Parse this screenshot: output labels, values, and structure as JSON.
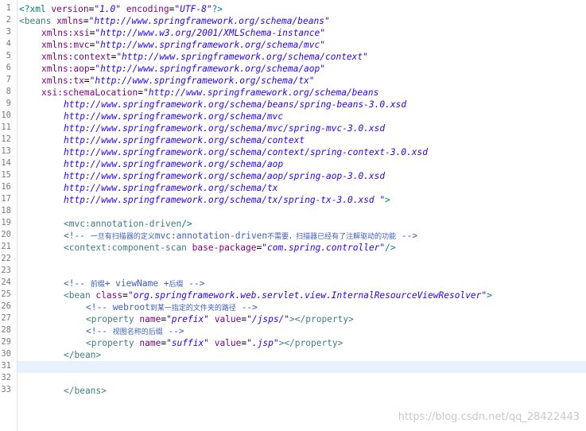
{
  "editor": {
    "current_line": 31,
    "line_numbers": [
      "1",
      "2",
      "3",
      "4",
      "5",
      "6",
      "7",
      "8",
      "9",
      "10",
      "11",
      "12",
      "13",
      "14",
      "15",
      "16",
      "17",
      "18",
      "19",
      "20",
      "21",
      "22",
      "23",
      "24",
      "25",
      "26",
      "27",
      "28",
      "29",
      "30",
      "31",
      "32",
      "33"
    ],
    "lines": {
      "l1": {
        "a": "<?xml ",
        "b": "version",
        "c": "=",
        "d": "\"1.0\"",
        "e": " ",
        "f": "encoding",
        "g": "=",
        "h": "\"UTF-8\"",
        "i": "?>"
      },
      "l2": {
        "a": "<beans ",
        "b": "xmlns",
        "c": "=",
        "d": "\"http://www.springframework.org/schema/beans\""
      },
      "l3": {
        "b": "xmlns:xsi",
        "c": "=",
        "d": "\"http://www.w3.org/2001/XMLSchema-instance\""
      },
      "l4": {
        "b": "xmlns:mvc",
        "c": "=",
        "d": "\"http://www.springframework.org/schema/mvc\""
      },
      "l5": {
        "b": "xmlns:context",
        "c": "=",
        "d": "\"http://www.springframework.org/schema/context\""
      },
      "l6": {
        "b": "xmlns:aop",
        "c": "=",
        "d": "\"http://www.springframework.org/schema/aop\""
      },
      "l7": {
        "b": "xmlns:tx",
        "c": "=",
        "d": "\"http://www.springframework.org/schema/tx\""
      },
      "l8": {
        "b": "xsi:schemaLocation",
        "c": "=",
        "d": "\"http://www.springframework.org/schema/beans"
      },
      "l9": {
        "d": "http://www.springframework.org/schema/beans/spring-beans-3.0.xsd"
      },
      "l10": {
        "d": "http://www.springframework.org/schema/mvc"
      },
      "l11": {
        "d": "http://www.springframework.org/schema/mvc/spring-mvc-3.0.xsd"
      },
      "l12": {
        "d": "http://www.springframework.org/schema/context"
      },
      "l13": {
        "d": "http://www.springframework.org/schema/context/spring-context-3.0.xsd"
      },
      "l14": {
        "d": "http://www.springframework.org/schema/aop"
      },
      "l15": {
        "d": "http://www.springframework.org/schema/aop/spring-aop-3.0.xsd"
      },
      "l16": {
        "d": "http://www.springframework.org/schema/tx"
      },
      "l17": {
        "d": "http://www.springframework.org/schema/tx/spring-tx-3.0.xsd \"",
        "i": ">"
      },
      "l19": {
        "a": "<mvc:annotation-driven",
        "i": "/>"
      },
      "l20": {
        "a": "<!-- ",
        "b": "一旦有扫描器的定义",
        "c": "mvc:annotation-driven",
        "d": "不需要，扫描器已经有了注解驱动的功能",
        "e": " -->"
      },
      "l21": {
        "a": "<context:component-scan ",
        "b": "base-package",
        "c": "=",
        "d": "\"com.spring.controller\"",
        "i": "/>"
      },
      "l24": {
        "a": "<!-- ",
        "b": "前缀",
        "c": "+ viewName +",
        "d": "后缀",
        "e": " -->"
      },
      "l25": {
        "a": "<bean ",
        "b": "class",
        "c": "=",
        "d": "\"org.springframework.web.servlet.view.InternalResourceViewResolver\"",
        "i": ">"
      },
      "l26": {
        "a": "<!-- ",
        "c": "webroot",
        "d": "到某一指定的文件夹的路径",
        "e": " -->"
      },
      "l27": {
        "a": "<property ",
        "b": "name",
        "c": "=",
        "d": "\"prefix\"",
        "e": " ",
        "f": "value",
        "g": "=",
        "h": "\"/jsps/\"",
        "i": "></property>"
      },
      "l28": {
        "a": "<!-- ",
        "d": "视图名称的后缀",
        "e": " -->"
      },
      "l29": {
        "a": "<property ",
        "b": "name",
        "c": "=",
        "d": "\"suffix\"",
        "e": " ",
        "f": "value",
        "g": "=",
        "h": "\".jsp\"",
        "i": "></property>"
      },
      "l30": {
        "a": "</bean>"
      },
      "l33": {
        "a": "</beans>"
      }
    }
  },
  "watermark": "https://blog.csdn.net/qq_28422443"
}
